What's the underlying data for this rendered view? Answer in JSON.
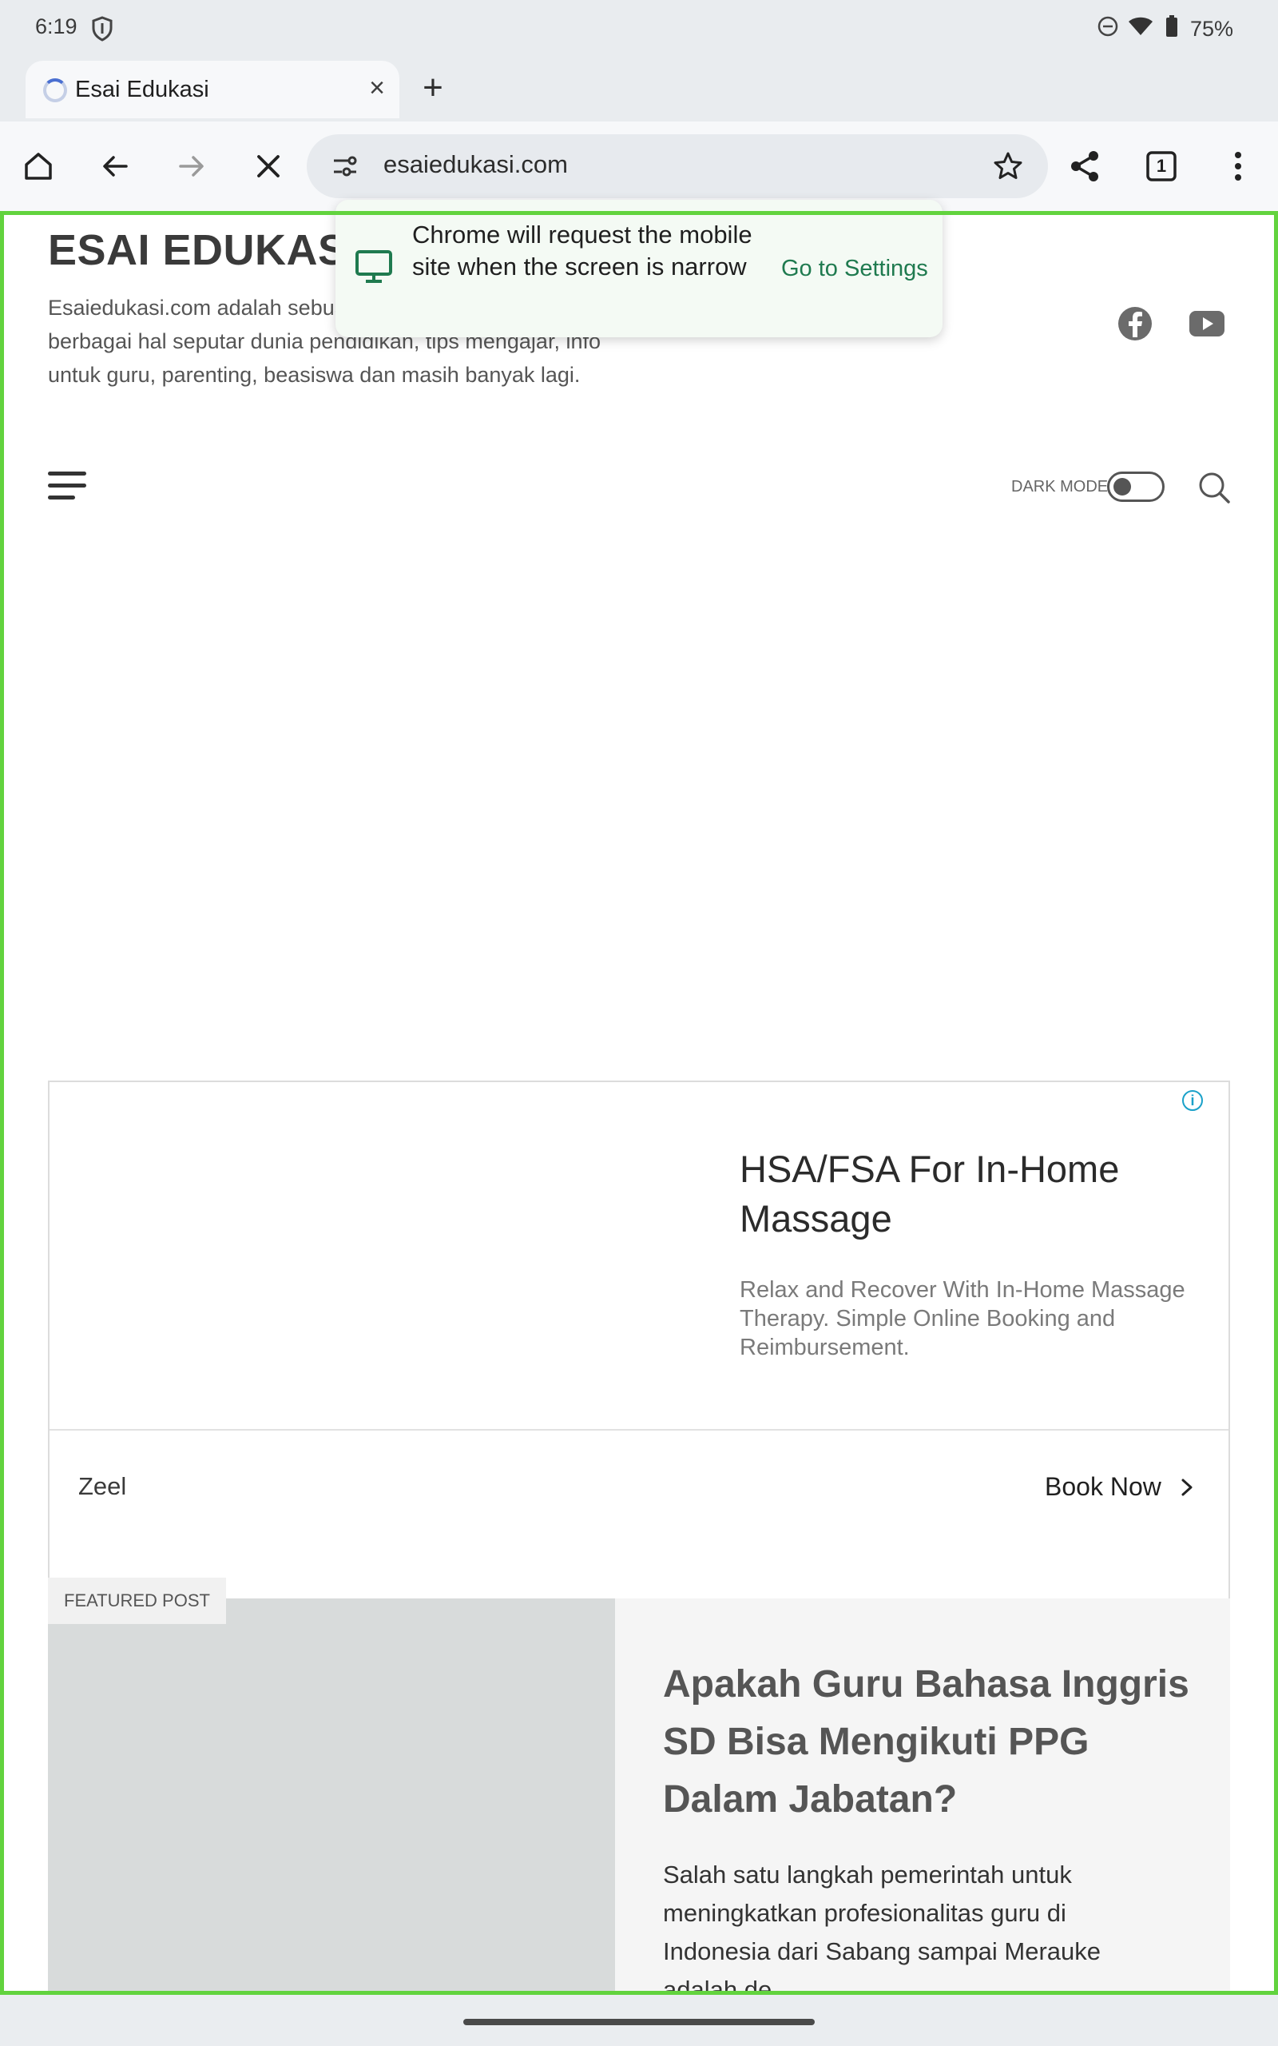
{
  "status_bar": {
    "time": "6:19",
    "battery": "75%"
  },
  "tab": {
    "title": "Esai Edukasi"
  },
  "toolbar": {
    "url": "esaiedukasi.com",
    "tab_count": "1"
  },
  "popup": {
    "message": "Chrome will request the mobile site when the screen is narrow",
    "action": "Go to Settings"
  },
  "site": {
    "title": "ESAI EDUKASI",
    "description": "Esaiedukasi.com adalah sebuah blog yang membahas berbagai hal seputar dunia pendidikan, tips mengajar, info untuk guru, parenting, beasiswa dan masih banyak lagi.",
    "dark_mode_label": "DARK MODE"
  },
  "ad": {
    "headline": "HSA/FSA For In-Home Massage",
    "body": "Relax and Recover With In-Home Massage Therapy. Simple Online Booking and Reimbursement.",
    "advertiser": "Zeel",
    "cta": "Book Now",
    "info_glyph": "i"
  },
  "featured": {
    "badge": "FEATURED POST",
    "title": "Apakah Guru Bahasa Inggris SD Bisa Mengikuti PPG Dalam Jabatan?",
    "excerpt": "Salah satu langkah pemerintah untuk meningkatkan profesionalitas guru di Indonesia dari Sabang sampai Merauke adalah de..."
  },
  "colors": {
    "accent_green": "#1f7a4f",
    "frame_green": "#62d33e",
    "ad_info": "#1aa1c9"
  }
}
